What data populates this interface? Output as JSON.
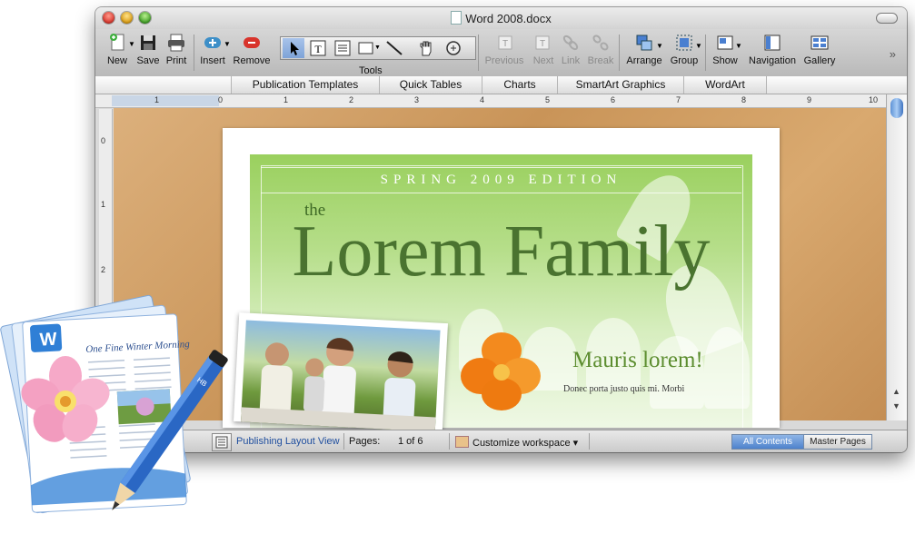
{
  "window": {
    "title": "Word 2008.docx"
  },
  "toolbar": {
    "new": "New",
    "save": "Save",
    "print": "Print",
    "insert": "Insert",
    "remove": "Remove",
    "tools": "Tools",
    "previous": "Previous",
    "next": "Next",
    "link": "Link",
    "break": "Break",
    "arrange": "Arrange",
    "group": "Group",
    "show": "Show",
    "navigation": "Navigation",
    "gallery": "Gallery"
  },
  "ribbon": {
    "tabs": [
      "Publication Templates",
      "Quick Tables",
      "Charts",
      "SmartArt Graphics",
      "WordArt"
    ]
  },
  "ruler": {
    "h_numbers": [
      "1",
      "0",
      "1",
      "2",
      "3",
      "4",
      "5",
      "6",
      "7",
      "8",
      "9",
      "10"
    ],
    "v_numbers": [
      "0",
      "1",
      "2"
    ]
  },
  "document": {
    "edition": "SPRING 2009 EDITION",
    "the": "the",
    "title": "Lorem Family",
    "heading": "Mauris lorem!",
    "body": "Donec porta justo quis mi. Morbi"
  },
  "status": {
    "view": "Publishing Layout View",
    "pages_label": "Pages:",
    "pages_value": "1 of 6",
    "customize": "Customize workspace",
    "all_contents": "All Contents",
    "master_pages": "Master Pages"
  },
  "badge": {
    "title": "One Fine Winter Morning",
    "pencil_text": "HB"
  },
  "colors": {
    "accent_green": "#4a7330",
    "selected_blue": "#4e82cc",
    "wood": "#d0a066"
  }
}
